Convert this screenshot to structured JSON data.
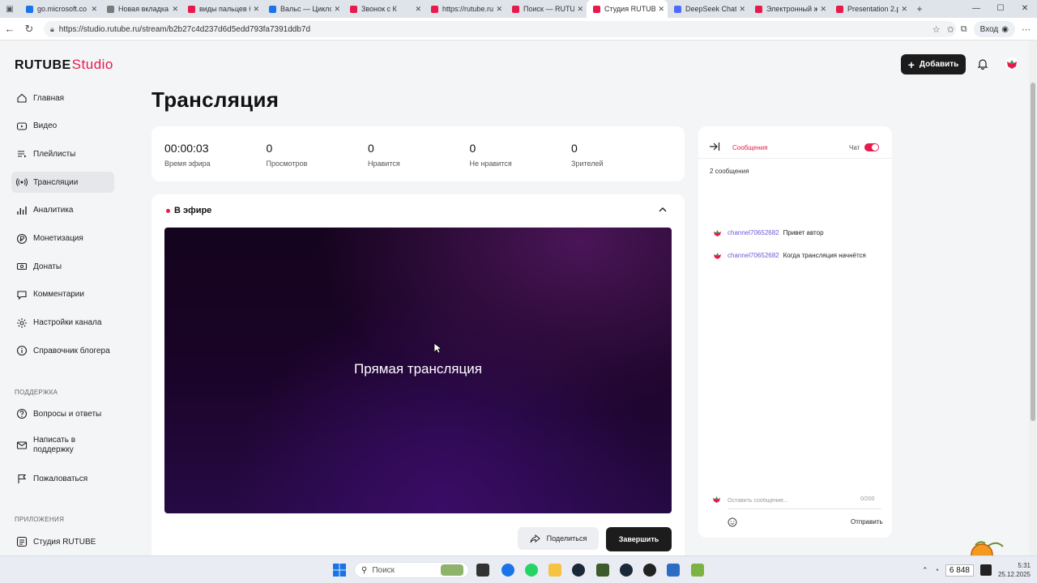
{
  "browser": {
    "tabs": [
      {
        "label": "go.microsoft.co",
        "color": "#1a73e8"
      },
      {
        "label": "Новая вкладка",
        "color": "#7a7a7a"
      },
      {
        "label": "виды пальцев б",
        "color": "#e8194b"
      },
      {
        "label": "Вальс — Цикло",
        "color": "#1a73e8"
      },
      {
        "label": "Звонок с К",
        "color": "#e8194b"
      },
      {
        "label": "https://rutube.ru",
        "color": "#e8194b"
      },
      {
        "label": "Поиск — RUTUB",
        "color": "#e8194b"
      },
      {
        "label": "Студия RUTUBE",
        "color": "#e8194b",
        "active": true
      },
      {
        "label": "DeepSeek Chat",
        "color": "#4d6bfe"
      },
      {
        "label": "Электронный ж",
        "color": "#e8194b"
      },
      {
        "label": "Presentation 2.p",
        "color": "#e8194b"
      }
    ],
    "url": "https://studio.rutube.ru/stream/b2b27c4d237d6d5edd793fa7391ddb7d",
    "login_label": "Вход"
  },
  "app": {
    "logo_main": "RUTUBE",
    "logo_studio": "Studio",
    "add_button": "Добавить"
  },
  "sidebar": {
    "items": [
      {
        "label": "Главная",
        "icon": "home-icon"
      },
      {
        "label": "Видео",
        "icon": "video-icon"
      },
      {
        "label": "Плейлисты",
        "icon": "playlist-icon"
      },
      {
        "label": "Трансляции",
        "icon": "broadcast-icon",
        "active": true
      },
      {
        "label": "Аналитика",
        "icon": "analytics-icon"
      },
      {
        "label": "Монетизация",
        "icon": "monetization-icon"
      },
      {
        "label": "Донаты",
        "icon": "donate-icon"
      },
      {
        "label": "Комментарии",
        "icon": "comments-icon"
      },
      {
        "label": "Настройки канала",
        "icon": "settings-icon"
      },
      {
        "label": "Справочник блогера",
        "icon": "info-icon"
      }
    ],
    "support_heading": "ПОДДЕРЖКА",
    "support_items": [
      {
        "label": "Вопросы и ответы"
      },
      {
        "label": "Написать в\nподдержку"
      },
      {
        "label": "Пожаловаться"
      }
    ],
    "apps_heading": "ПРИЛОЖЕНИЯ",
    "apps_items": [
      {
        "label": "Студия RUTUBE"
      }
    ]
  },
  "main": {
    "title": "Трансляция",
    "stats": [
      {
        "value": "00:00:03",
        "label": "Время эфира"
      },
      {
        "value": "0",
        "label": "Просмотров"
      },
      {
        "value": "0",
        "label": "Нравится"
      },
      {
        "value": "0",
        "label": "Не нравится"
      },
      {
        "value": "0",
        "label": "Зрителей"
      }
    ],
    "live_status": "В эфире",
    "video_text": "Прямая трансляция",
    "share_button": "Поделиться",
    "finish_button": "Завершить"
  },
  "chat": {
    "tab_messages": "Сообщения",
    "toggle_label": "Чат",
    "chat_enabled": true,
    "message_count": "2 сообщения",
    "messages": [
      {
        "author": "channel70652682",
        "text": "Привет автор"
      },
      {
        "author": "channel70652682",
        "text": "Когда трансляция начнётся"
      }
    ],
    "input_placeholder": "Оставить сообщение...",
    "char_counter": "0/200",
    "send_button": "Отправить"
  },
  "taskbar": {
    "search_label": "Поиск",
    "tray_badge": "6 848",
    "time": "5:31",
    "date": "25.12.2025"
  },
  "colors": {
    "accent": "#e8194b",
    "author": "#6b5bd6",
    "dark_button": "#1c1c1c"
  }
}
